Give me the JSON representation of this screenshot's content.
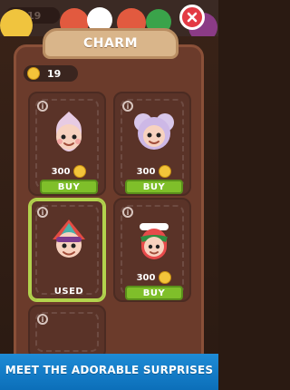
{
  "header": {
    "top_coins": "19",
    "title": "CHARM"
  },
  "wallet": {
    "coins": "19"
  },
  "items": [
    {
      "price": "300",
      "action": "BUY",
      "character": "onion"
    },
    {
      "price": "300",
      "action": "BUY",
      "character": "koala"
    },
    {
      "price": "",
      "action": "USED",
      "character": "clown"
    },
    {
      "price": "300",
      "action": "BUY",
      "character": "watermelon"
    },
    {
      "price": "",
      "action": "",
      "character": "partial"
    }
  ],
  "banner": {
    "text": "MEET THE ADORABLE SURPRISES"
  },
  "colors": {
    "panel": "#6b3b2b",
    "ribbon": "#d9b58a",
    "buy": "#7fbf2a",
    "close": "#e33a44",
    "banner": "#1e8bd6"
  },
  "icons": {
    "close": "close-icon",
    "coin": "coin-icon",
    "info": "info-icon"
  }
}
